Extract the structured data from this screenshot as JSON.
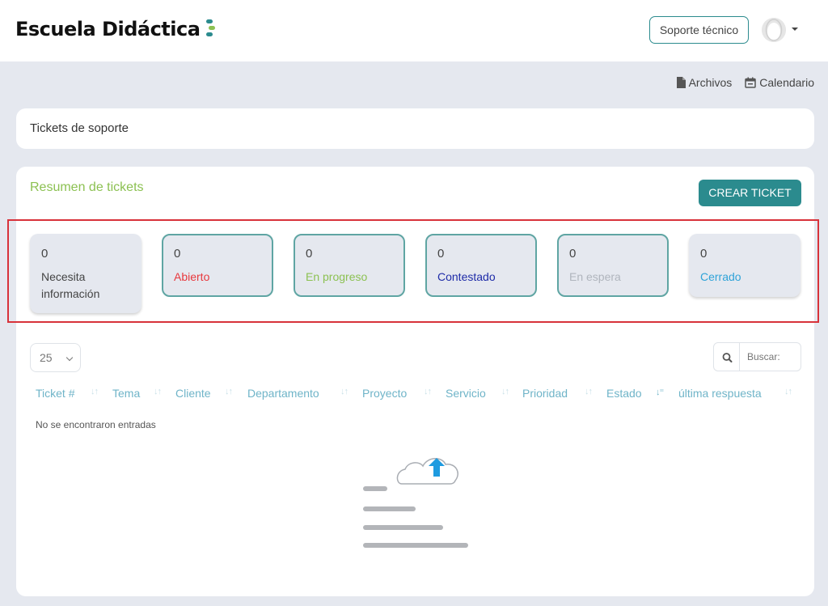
{
  "header": {
    "logo_text": "Escuela Didáctica",
    "support_label": "Soporte técnico"
  },
  "quicklinks": [
    {
      "label": "Archivos",
      "icon": "file-icon"
    },
    {
      "label": "Calendario",
      "icon": "calendar-icon"
    }
  ],
  "page_title": "Tickets de soporte",
  "summary": {
    "title": "Resumen de tickets",
    "create_label": "CREAR TICKET",
    "stats": [
      {
        "count": "0",
        "label": "Necesita información",
        "color": "#444444"
      },
      {
        "count": "0",
        "label": "Abierto",
        "color": "#e8383d"
      },
      {
        "count": "0",
        "label": "En progreso",
        "color": "#8cc152"
      },
      {
        "count": "0",
        "label": "Contestado",
        "color": "#1e2ba8"
      },
      {
        "count": "0",
        "label": "En espera",
        "color": "#b0b5bd"
      },
      {
        "count": "0",
        "label": "Cerrado",
        "color": "#2fa3d8"
      }
    ]
  },
  "table": {
    "page_length": "25",
    "search_placeholder": "Buscar:",
    "columns": [
      "Ticket #",
      "Tema",
      "Cliente",
      "Departamento",
      "Proyecto",
      "Servicio",
      "Prioridad",
      "Estado",
      "última respuesta"
    ],
    "empty_message": "No se encontraron entradas"
  },
  "colors": {
    "accent": "#2b8b8e",
    "header_text": "#6fb4c8",
    "highlight": "#d8323a",
    "logo_green": "#8cc152"
  }
}
